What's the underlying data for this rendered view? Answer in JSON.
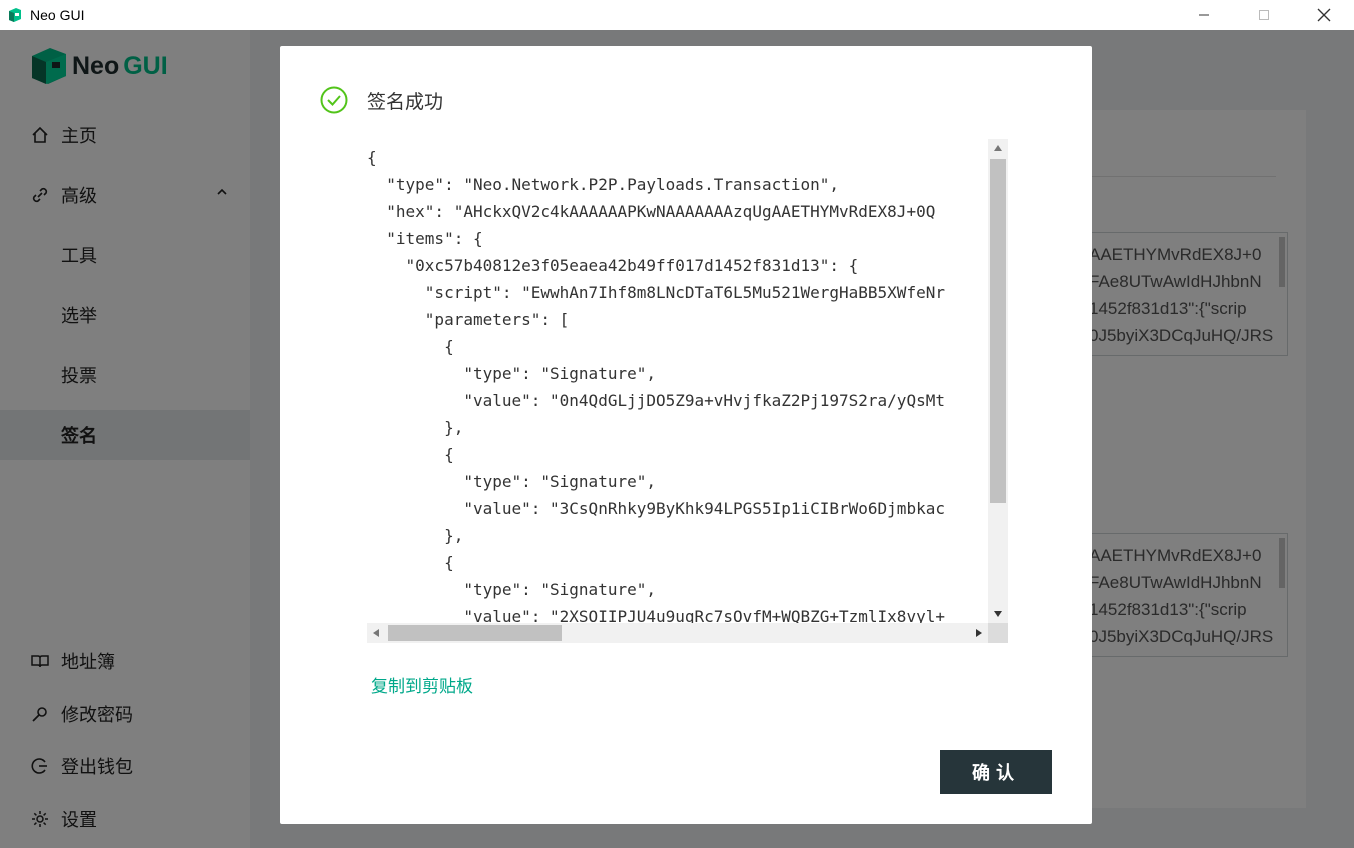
{
  "window": {
    "title": "Neo GUI"
  },
  "logo": {
    "part1": "Neo",
    "part2": "GUI"
  },
  "sidebar": {
    "items": [
      {
        "label": "主页",
        "icon": "home-icon"
      },
      {
        "label": "高级",
        "icon": "link-icon"
      },
      {
        "label": "工具"
      },
      {
        "label": "选举"
      },
      {
        "label": "投票"
      },
      {
        "label": "签名"
      },
      {
        "label": "地址簿",
        "icon": "book-icon"
      },
      {
        "label": "修改密码",
        "icon": "key-icon"
      },
      {
        "label": "登出钱包",
        "icon": "logout-icon"
      },
      {
        "label": "设置",
        "icon": "gear-icon"
      }
    ]
  },
  "background": {
    "textarea1": [
      "AAETHYMvRdEX8J+0",
      "FAe8UTwAwIdHJhbnN",
      "1452f831d13\":{\"scrip",
      "0J5byiX3DCqJuHQ/JRS"
    ],
    "textarea2": [
      "AAETHYMvRdEX8J+0",
      "FAe8UTwAwIdHJhbnN",
      "1452f831d13\":{\"scrip",
      "0J5byiX3DCqJuHQ/JRS"
    ]
  },
  "modal": {
    "title": "签名成功",
    "code_lines": [
      "{",
      "  \"type\": \"Neo.Network.P2P.Payloads.Transaction\",",
      "  \"hex\": \"AHckxQV2c4kAAAAAAPKwNAAAAAAAzqUgAAETHYMvRdEX8J+0Q",
      "  \"items\": {",
      "    \"0xc57b40812e3f05eaea42b49ff017d1452f831d13\": {",
      "      \"script\": \"EwwhAn7Ihf8m8LNcDTaT6L5Mu521WergHaBB5XWfeNr",
      "      \"parameters\": [",
      "        {",
      "          \"type\": \"Signature\",",
      "          \"value\": \"0n4QdGLjjDO5Z9a+vHvjfkaZ2Pj197S2ra/yQsMt",
      "        },",
      "        {",
      "          \"type\": \"Signature\",",
      "          \"value\": \"3CsQnRhky9ByKhk94LPGS5Ip1iCIBrWo6Djmbkac",
      "        },",
      "        {",
      "          \"type\": \"Signature\",",
      "          \"value\": \"2XSOIIPJU4u9uqRc7sOvfM+WQBZG+TzmlIx8vyl+"
    ],
    "copy_label": "复制到剪贴板",
    "confirm_label": "确认"
  },
  "colors": {
    "accent": "#00a88a",
    "success": "#52c41a",
    "button_bg": "#26353a"
  }
}
